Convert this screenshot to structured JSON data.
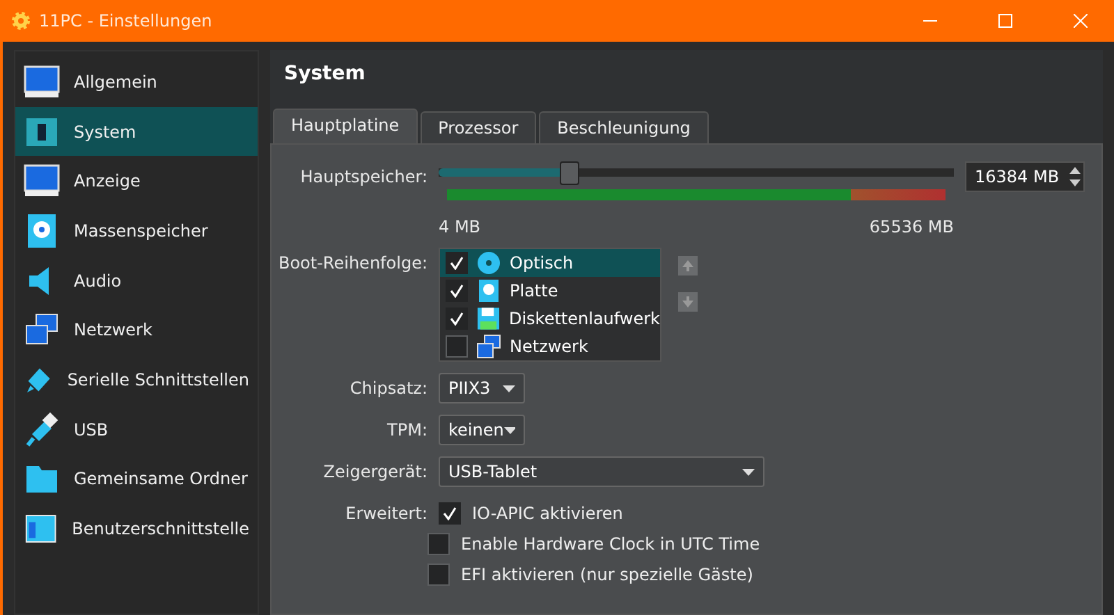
{
  "window": {
    "title": "11PC - Einstellungen"
  },
  "sidebar": {
    "items": [
      {
        "label": "Allgemein",
        "kind": "monitor",
        "selected": false
      },
      {
        "label": "System",
        "kind": "chip",
        "selected": true
      },
      {
        "label": "Anzeige",
        "kind": "monitor",
        "selected": false
      },
      {
        "label": "Massenspeicher",
        "kind": "disk",
        "selected": false
      },
      {
        "label": "Audio",
        "kind": "audio",
        "selected": false
      },
      {
        "label": "Netzwerk",
        "kind": "network",
        "selected": false
      },
      {
        "label": "Serielle Schnittstellen",
        "kind": "serial",
        "selected": false
      },
      {
        "label": "USB",
        "kind": "usb",
        "selected": false
      },
      {
        "label": "Gemeinsame Ordner",
        "kind": "folder",
        "selected": false
      },
      {
        "label": "Benutzerschnittstelle",
        "kind": "ui",
        "selected": false
      }
    ]
  },
  "page_title": "System",
  "tabs": [
    {
      "label": "Hauptplatine",
      "selected": true
    },
    {
      "label": "Prozessor",
      "selected": false
    },
    {
      "label": "Beschleunigung",
      "selected": false
    }
  ],
  "memory": {
    "label": "Hauptspeicher:",
    "level": 0.25,
    "min_label": "4 MB",
    "max_label": "65536 MB",
    "value": "16384 MB"
  },
  "boot_order": {
    "label": "Boot-Reihenfolge:",
    "items": [
      {
        "label": "Optisch",
        "kind": "optical",
        "checked": true,
        "selected": true
      },
      {
        "label": "Platte",
        "kind": "disk",
        "checked": true,
        "selected": false
      },
      {
        "label": "Diskettenlaufwerk",
        "kind": "floppy",
        "checked": true,
        "selected": false
      },
      {
        "label": "Netzwerk",
        "kind": "network",
        "checked": false,
        "selected": false
      }
    ]
  },
  "dropdowns": [
    {
      "label": "Chipsatz:",
      "value": "PIIX3",
      "kind": "compact"
    },
    {
      "label": "TPM:",
      "value": "keinen",
      "kind": "compact"
    },
    {
      "label": "Zeigergerät:",
      "value": "USB-Tablet",
      "kind": "wide"
    }
  ],
  "extended": {
    "label": "Erweitert:",
    "options": [
      {
        "label": "IO-APIC aktivieren",
        "checked": true
      },
      {
        "label": "Enable Hardware Clock in UTC Time",
        "checked": false
      },
      {
        "label": "EFI aktivieren (nur spezielle Gäste)",
        "checked": false
      }
    ]
  }
}
